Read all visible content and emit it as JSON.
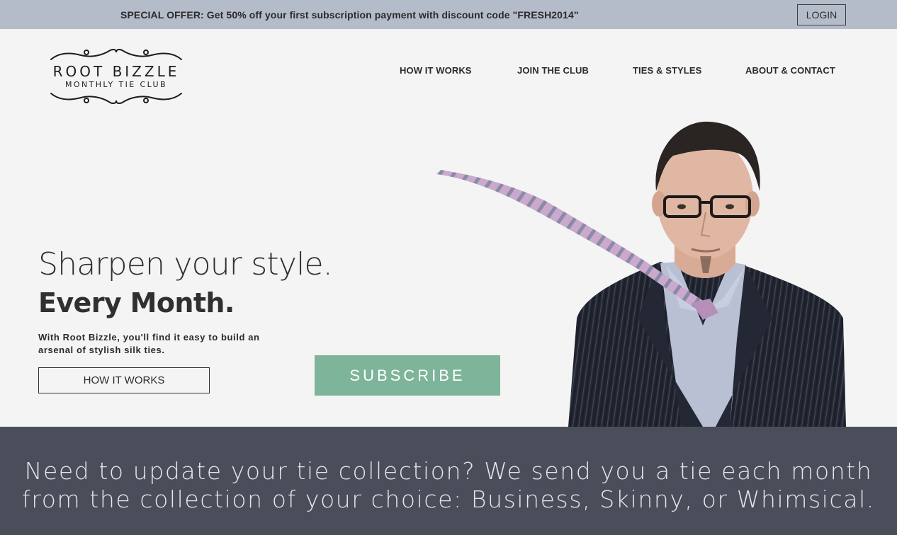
{
  "promo": {
    "text": "SPECIAL OFFER: Get 50% off your first subscription payment with discount code \"FRESH2014\"",
    "login_label": "LOGIN"
  },
  "logo": {
    "name": "ROOT BIZZLE",
    "tagline": "MONTHLY TIE CLUB"
  },
  "nav": {
    "items": [
      {
        "label": "HOW IT WORKS"
      },
      {
        "label": "JOIN THE CLUB"
      },
      {
        "label": "TIES & STYLES"
      },
      {
        "label": "ABOUT & CONTACT"
      }
    ]
  },
  "hero": {
    "title": "Sharpen your style.",
    "subtitle": "Every Month.",
    "description": "With Root Bizzle, you'll find it easy to build an arsenal of stylish silk ties.",
    "how_label": "HOW IT WORKS",
    "subscribe_label": "SUBSCRIBE"
  },
  "banner": {
    "line1": "Need to update your tie collection? We send you a tie each month",
    "line2": "from the collection of your choice: Business, Skinny, or Whimsical."
  },
  "colors": {
    "promo_bg": "#b5bcc9",
    "page_bg": "#f4f4f4",
    "subscribe_bg": "#7db49a",
    "banner_bg": "#4a4e5a",
    "tie_color": "#c9a5c9"
  }
}
